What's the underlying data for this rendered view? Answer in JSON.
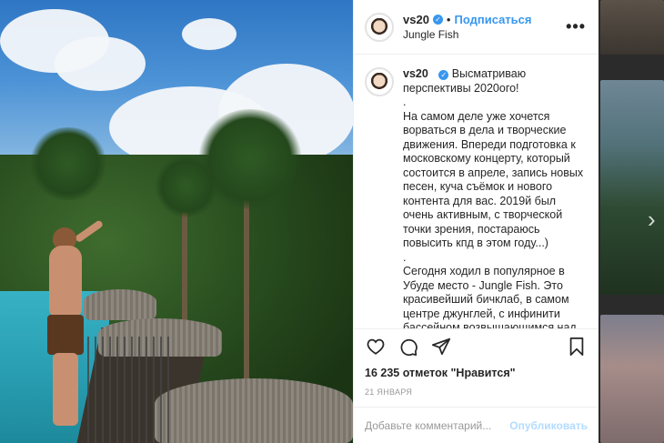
{
  "post": {
    "username": "vs20",
    "follow_label": "Подписаться",
    "location": "Jungle Fish",
    "more_label": "•••",
    "caption": {
      "lines": [
        "Высматриваю перспективы 2020ого!",
        ".",
        "На самом деле уже хочется ворваться в дела и творческие движения. Впереди подготовка к московскому концерту, который состоится в апреле, запись новых песен, куча съёмок и нового контента для вас. 2019й был очень активным, с творческой точки зрения, постараюсь повысить кпд в этом году...)",
        ".",
        "Сегодня ходил в популярное в Убуде место - Jungle Fish. Это красивейший бичклаб, в самом центре джунглей, с инфинити бассейном возвышающимся над большим каньоном! Вид - пушка"
      ]
    },
    "likes": "16 235 отметок \"Нравится\"",
    "date": "21 ЯНВАРЯ",
    "comment_placeholder": "Добавьте комментарий...",
    "publish_label": "Опубликовать"
  },
  "icons": {
    "like": "heart-icon",
    "comment": "comment-icon",
    "share": "share-icon",
    "save": "bookmark-icon",
    "verified": "verified-badge-icon",
    "next": "chevron-right-icon"
  },
  "colors": {
    "accent": "#3897f0",
    "text": "#262626",
    "muted": "#999999",
    "border": "#efefef",
    "publish_disabled": "#b3dbff"
  }
}
